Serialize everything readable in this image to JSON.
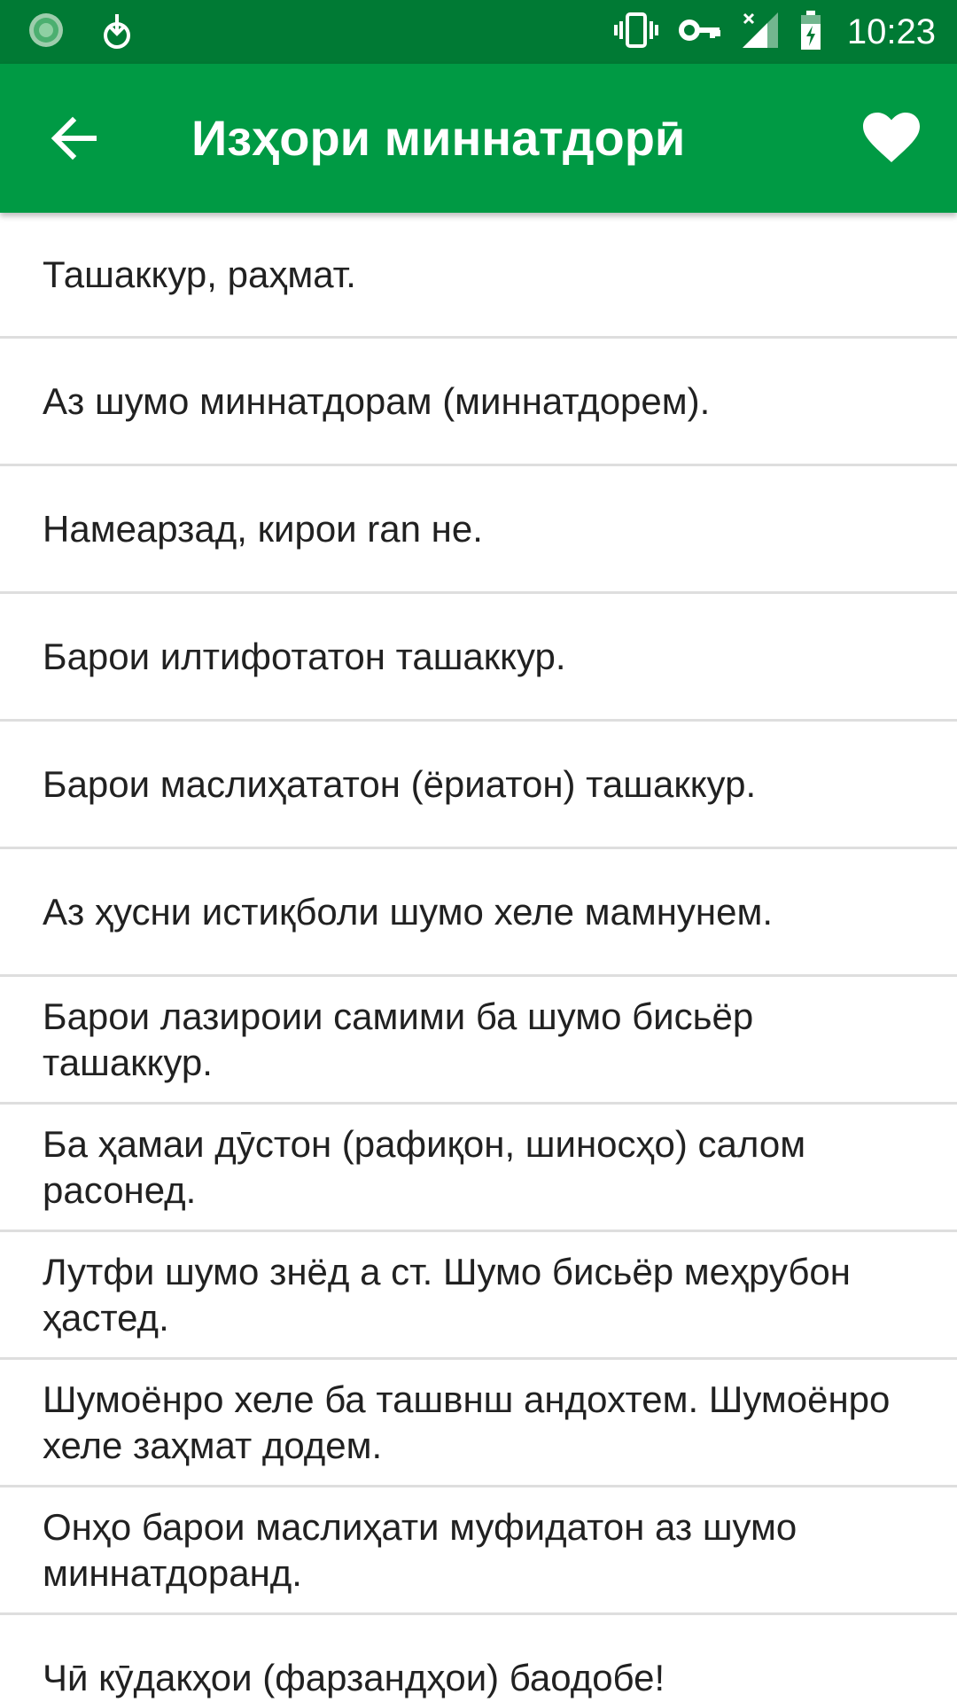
{
  "status_bar": {
    "time": "10:23",
    "left_icons": [
      "app-notification-icon",
      "download-notification-icon"
    ],
    "right_icons": [
      "vibrate-icon",
      "vpn-key-icon",
      "signal-no-data-icon",
      "battery-charging-icon"
    ]
  },
  "app_bar": {
    "title": "Изҳори миннатдорӣ",
    "back_icon": "arrow-left-icon",
    "favorite_icon": "heart-icon"
  },
  "phrases": [
    "Ташаккур, раҳмат.",
    "Аз шумо миннатдорам (миннатдорем).",
    "Намеарзад, кирои ran не.",
    "Барои илтифотатон ташаккур.",
    "Барои маслиҳататон (ёриатон) ташаккур.",
    "Аз ҳусни истиқболи шумо хеле мамнунем.",
    "Барои лазироии самими ба шумо бисьёр ташаккур.",
    "Ба ҳамаи дӯстон (рафиқон, шиносҳо) салом расонед.",
    "Лутфи шумо знёд а ст. Шумо бисьёр меҳрубон ҳастед.",
    "Шумоёнро хеле ба ташвнш андохтем. Шумоёнро хеле заҳмат додем.",
    "Онҳо барои маслиҳати муфидатон аз шумо миннатдоранд.",
    "Чӣ кӯдакҳои (фарзандҳои) баодобе!"
  ],
  "colors": {
    "status_bar": "#007a34",
    "app_bar": "#009a44",
    "divider": "#dedede",
    "text": "#212121"
  }
}
